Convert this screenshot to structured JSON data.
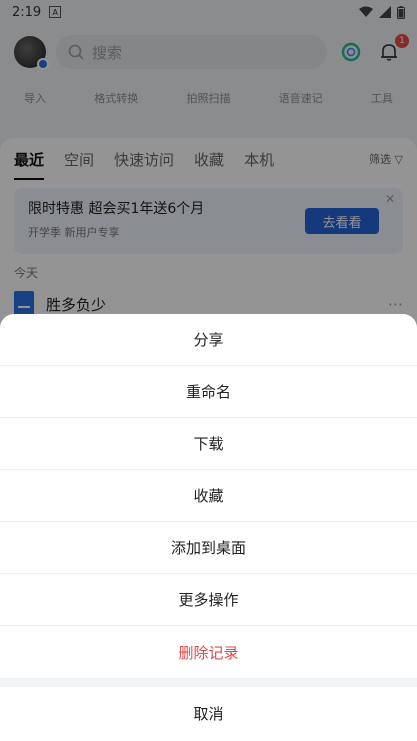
{
  "status": {
    "time": "2:19",
    "a_icon": "A"
  },
  "header": {
    "search_placeholder": "搜索",
    "notification_count": "1"
  },
  "quick_actions": [
    "导入",
    "格式转换",
    "拍照扫描",
    "语音速记",
    "工具"
  ],
  "tabs": {
    "items": [
      "最近",
      "空间",
      "快速访问",
      "收藏",
      "本机"
    ],
    "filter_label": "筛选"
  },
  "promo": {
    "title": "限时特惠 超会买1年送6个月",
    "subtitle": "开学季 新用户专享",
    "cta": "去看看"
  },
  "section": {
    "today": "今天"
  },
  "file": {
    "name": "胜多负少"
  },
  "sheet": {
    "items": [
      "分享",
      "重命名",
      "下载",
      "收藏",
      "添加到桌面",
      "更多操作"
    ],
    "danger_item": "删除记录",
    "cancel": "取消"
  },
  "colors": {
    "accent": "#2563d8",
    "danger": "#e04848",
    "badge": "#e54b4b"
  }
}
